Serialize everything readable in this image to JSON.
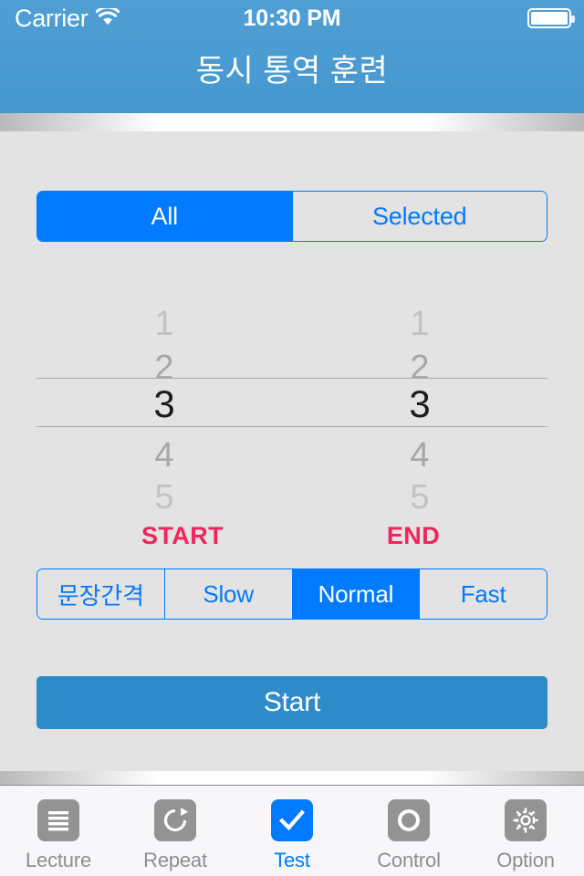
{
  "status_bar": {
    "carrier": "Carrier",
    "wifi_icon": "wifi-icon",
    "time": "10:30 PM",
    "battery_icon": "battery-icon"
  },
  "navbar": {
    "title": "동시 통역 훈련",
    "background_color": "#4a9bd1"
  },
  "scope_control": {
    "segments": [
      {
        "label": "All",
        "selected": true
      },
      {
        "label": "Selected",
        "selected": false
      }
    ],
    "accent_color": "#007aff"
  },
  "pickers": {
    "start_wheel": {
      "name": "start",
      "rows": [
        "1",
        "2",
        "3",
        "4",
        "5"
      ],
      "selected_value": "3",
      "selected_index": 2
    },
    "end_wheel": {
      "name": "end",
      "rows": [
        "1",
        "2",
        "3",
        "4",
        "5"
      ],
      "selected_value": "3",
      "selected_index": 2
    }
  },
  "range_labels": {
    "start": "START",
    "end": "END",
    "color": "#f2245c"
  },
  "speed_control": {
    "segments": [
      {
        "label": "문장간격",
        "selected": false
      },
      {
        "label": "Slow",
        "selected": false
      },
      {
        "label": "Normal",
        "selected": true
      },
      {
        "label": "Fast",
        "selected": false
      }
    ],
    "accent_color": "#007aff"
  },
  "start_button": {
    "label": "Start",
    "color": "#2e8bc9"
  },
  "tabbar": {
    "items": [
      {
        "label": "Lecture",
        "icon": "list-lines-icon",
        "active": false
      },
      {
        "label": "Repeat",
        "icon": "refresh-circle-arrow-icon",
        "active": false
      },
      {
        "label": "Test",
        "icon": "checkmark-icon",
        "active": true
      },
      {
        "label": "Control",
        "icon": "ring-circle-icon",
        "active": false
      },
      {
        "label": "Option",
        "icon": "gear-icon",
        "active": false
      }
    ],
    "active_color": "#007aff",
    "inactive_color": "#8e8e93"
  }
}
